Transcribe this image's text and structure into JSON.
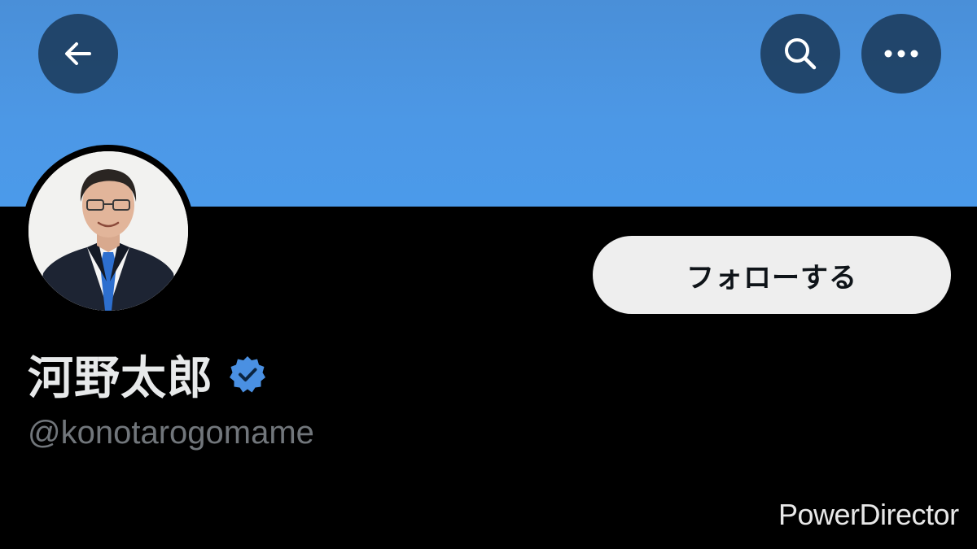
{
  "header": {
    "back_icon": "arrow-left-icon",
    "search_icon": "search-icon",
    "more_icon": "more-horizontal-icon"
  },
  "profile": {
    "display_name": "河野太郎",
    "handle": "@konotarogomame",
    "verified": true,
    "verified_icon": "verified-badge-icon",
    "follow_label": "フォローする"
  },
  "watermark": {
    "text": "PowerDirector"
  },
  "colors": {
    "banner": "#4b95e3",
    "background": "#000000",
    "button_overlay": "#183452",
    "follow_button_bg": "#eeeeee",
    "verified": "#4a90e2",
    "handle_text": "#71767b"
  }
}
